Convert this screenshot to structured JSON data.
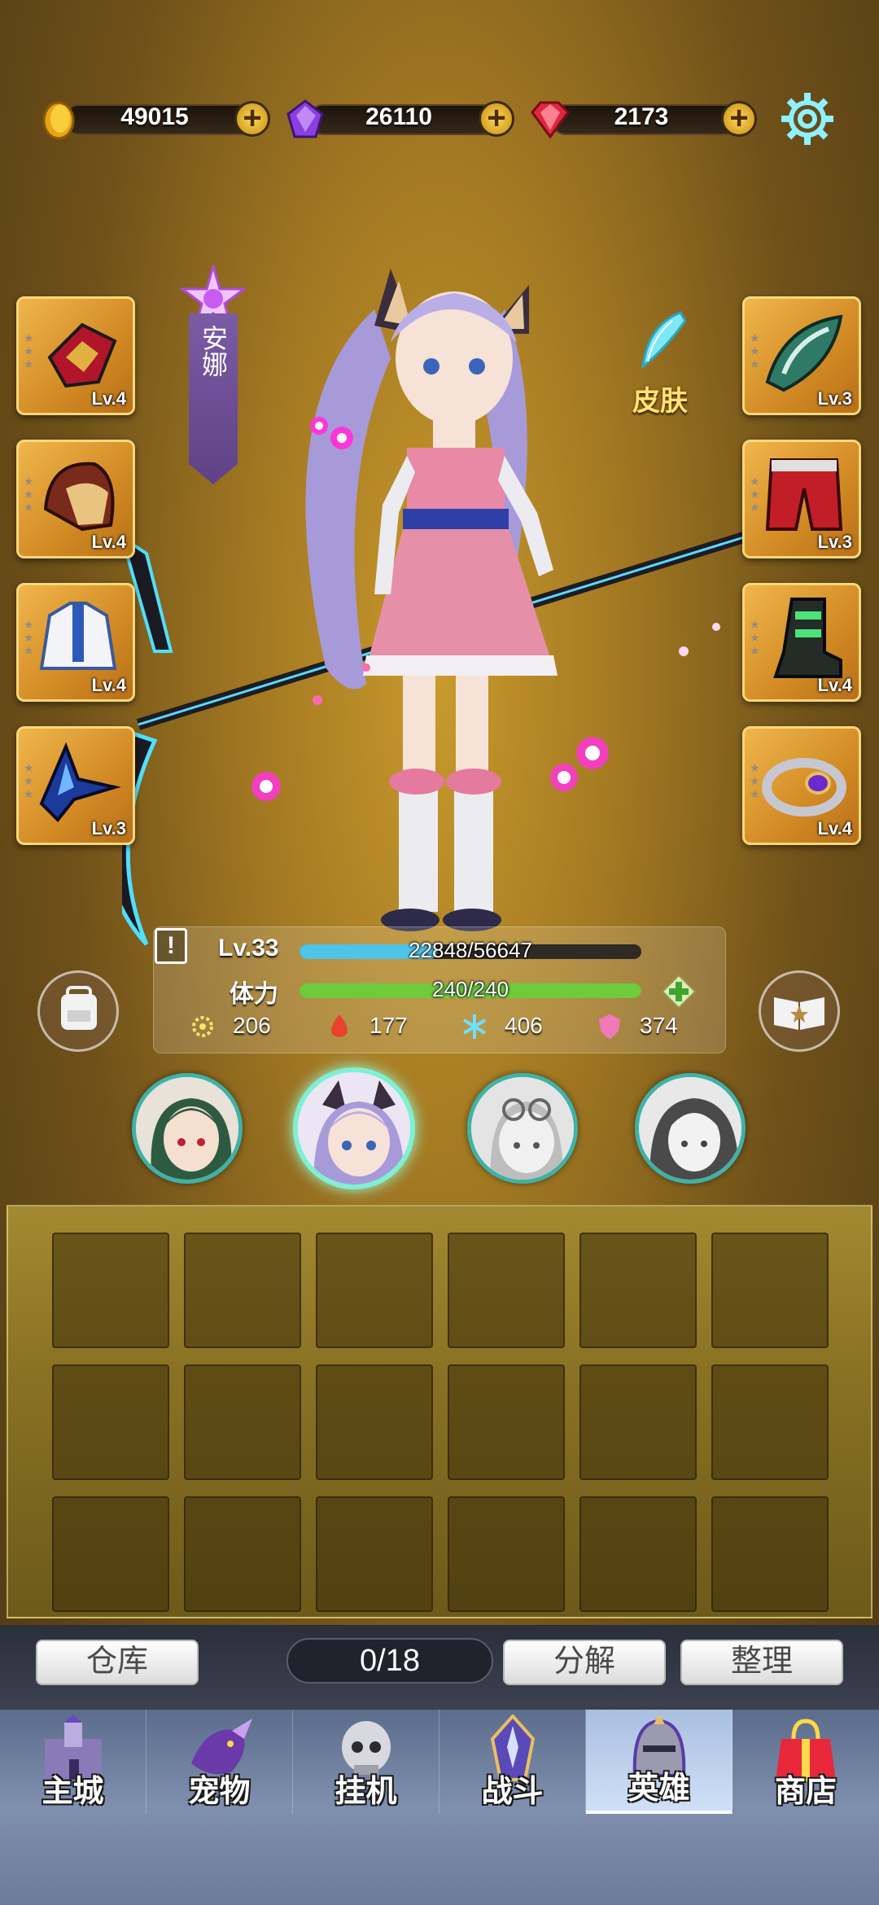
{
  "currencies": [
    {
      "icon": "gold-coin-icon",
      "value": "49015"
    },
    {
      "icon": "purple-crystal-icon",
      "value": "26110"
    },
    {
      "icon": "red-gem-icon",
      "value": "2173"
    }
  ],
  "hero_name": "安娜",
  "skin_label": "皮肤",
  "equipment_left": [
    {
      "name": "gauntlet",
      "level": "Lv.4"
    },
    {
      "name": "helmet",
      "level": "Lv.4"
    },
    {
      "name": "armor",
      "level": "Lv.4"
    },
    {
      "name": "wing",
      "level": "Lv.3"
    }
  ],
  "equipment_right": [
    {
      "name": "shoulder",
      "level": "Lv.3"
    },
    {
      "name": "pants",
      "level": "Lv.3"
    },
    {
      "name": "boots",
      "level": "Lv.4"
    },
    {
      "name": "ring",
      "level": "Lv.4"
    }
  ],
  "stats": {
    "level": "Lv.33",
    "exp": "22848/56647",
    "exp_fraction": 0.403,
    "stamina_label": "体力",
    "stamina": "240/240",
    "stamina_fraction": 1.0,
    "attrs": [
      "206",
      "177",
      "406",
      "374"
    ]
  },
  "inventory": {
    "count": "0/18",
    "warehouse": "仓库",
    "decompose": "分解",
    "organize": "整理"
  },
  "nav": [
    {
      "label": "主城",
      "icon": "castle-icon"
    },
    {
      "label": "宠物",
      "icon": "dragon-icon"
    },
    {
      "label": "挂机",
      "icon": "skull-helmet-icon"
    },
    {
      "label": "战斗",
      "icon": "sword-emblem-icon"
    },
    {
      "label": "英雄",
      "icon": "knight-helmet-icon",
      "active": true
    },
    {
      "label": "商店",
      "icon": "gift-bag-icon"
    }
  ],
  "colors": {
    "exp_bar": "#4fc3e8",
    "stamina_bar": "#6ecb3c",
    "accent_gold": "#f7d77c"
  }
}
